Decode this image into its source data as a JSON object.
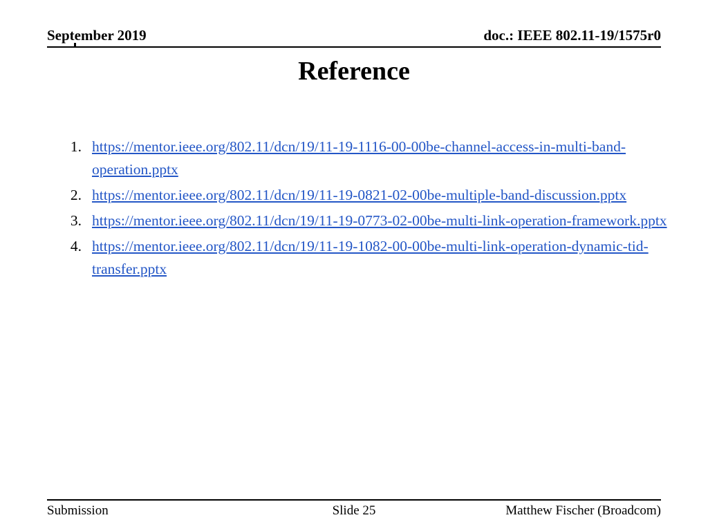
{
  "header": {
    "date": "September 2019",
    "doc": "doc.: IEEE 802.11-19/1575r0"
  },
  "title": "Reference",
  "references": {
    "items": [
      {
        "number": "1.",
        "url": "https://mentor.ieee.org/802.11/dcn/19/11-19-1116-00-00be-channel-access-in-multi-band-operation.pptx"
      },
      {
        "number": "2.",
        "url": "https://mentor.ieee.org/802.11/dcn/19/11-19-0821-02-00be-multiple-band-discussion.pptx"
      },
      {
        "number": "3.",
        "url": "https://mentor.ieee.org/802.11/dcn/19/11-19-0773-02-00be-multi-link-operation-framework.pptx"
      },
      {
        "number": "4.",
        "url": "https://mentor.ieee.org/802.11/dcn/19/11-19-1082-00-00be-multi-link-operation-dynamic-tid-transfer.pptx"
      }
    ]
  },
  "footer": {
    "left": "Submission",
    "center": "Slide 25",
    "right": "Matthew Fischer (Broadcom)"
  },
  "colors": {
    "link": "#2356C6",
    "text": "#000000",
    "background": "#ffffff"
  }
}
